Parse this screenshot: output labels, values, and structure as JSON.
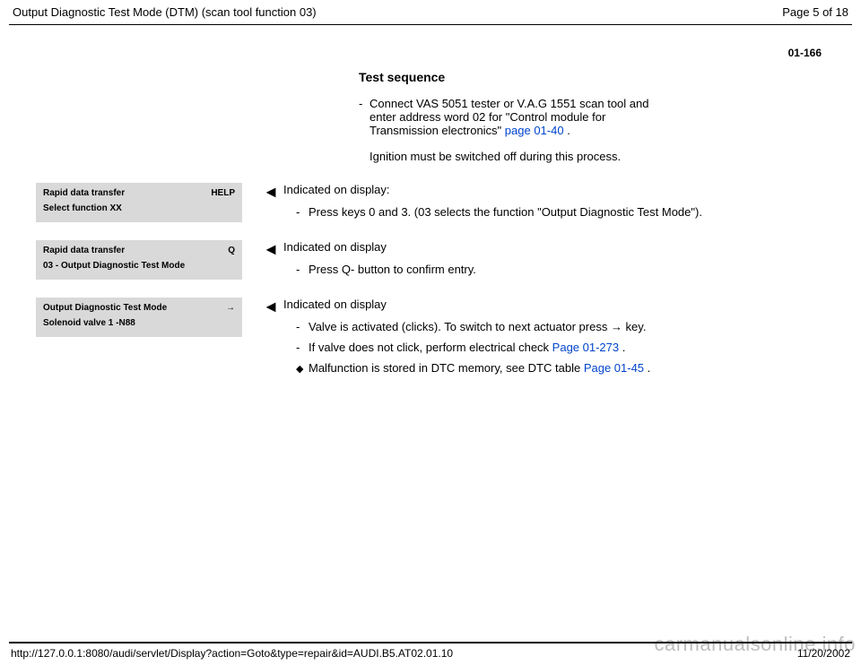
{
  "header": {
    "title": "Output Diagnostic Test Mode (DTM) (scan tool function 03)",
    "page_of": "Page 5 of 18"
  },
  "page_number": "01-166",
  "section_title": "Test sequence",
  "intro": {
    "dash": "-",
    "text_a": "Connect VAS 5051 tester or V.A.G 1551 scan tool and enter address word 02 for \"Control module for Transmission electronics\"  ",
    "link1": "page 01-40",
    "period": " .",
    "note": "Ignition must be switched off during this process."
  },
  "blocks": [
    {
      "display": {
        "left": "Rapid data transfer",
        "right": "HELP",
        "line2": "Select function XX"
      },
      "heading": "Indicated on display:",
      "items": [
        {
          "dash": "-",
          "text": "Press keys 0 and 3. (03 selects the function \"Output Diagnostic Test Mode\")."
        }
      ]
    },
    {
      "display": {
        "left": "Rapid data transfer",
        "right": "Q",
        "line2": "03 - Output Diagnostic Test Mode"
      },
      "heading": "Indicated on display",
      "items": [
        {
          "dash": "-",
          "text": "Press Q- button to confirm entry."
        }
      ]
    },
    {
      "display": {
        "left": "Output Diagnostic Test Mode",
        "right": "→",
        "line2": "Solenoid valve 1 -N88"
      },
      "heading": "Indicated on display",
      "items": [
        {
          "dash": "-",
          "text_a": "Valve is activated (clicks). To switch to next actuator press ",
          "arrow": "→",
          "text_b": " key."
        },
        {
          "dash": "-",
          "text_a": "If valve does not click, perform electrical check  ",
          "link": "Page 01-273",
          "text_b": " ."
        },
        {
          "bullet": "◆",
          "text_a": "Malfunction is stored in DTC memory, see DTC table  ",
          "link": "Page 01-45",
          "text_b": " ."
        }
      ]
    }
  ],
  "footer": {
    "url": "http://127.0.0.1:8080/audi/servlet/Display?action=Goto&type=repair&id=AUDI.B5.AT02.01.10",
    "date": "11/20/2002"
  },
  "watermark": "carmanualsonline.info",
  "arrow_left": "◄"
}
